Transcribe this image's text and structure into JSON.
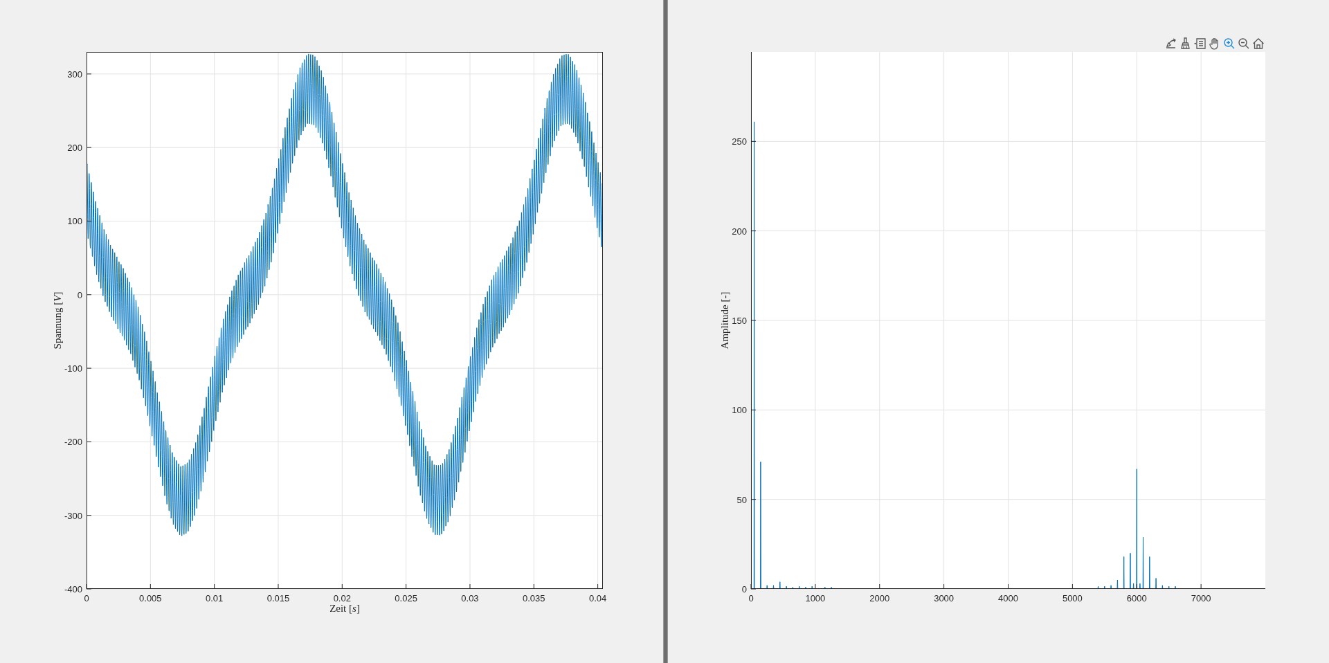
{
  "figures": [
    {
      "kind": "time",
      "box": true,
      "xlabel": "Zeit [*s*]",
      "ylabel": "Spannung [*V*]",
      "xticks": [
        "0",
        "0.005",
        "0.01",
        "0.015",
        "0.02",
        "0.025",
        "0.03",
        "0.035",
        "0.04"
      ],
      "yticks": [
        "300",
        "200",
        "100",
        "0",
        "-100",
        "-200",
        "-300",
        "-400"
      ]
    },
    {
      "kind": "spectrum",
      "box": false,
      "ylabel": "Amplitude [-]",
      "xticks": [
        "0",
        "1000",
        "2000",
        "3000",
        "4000",
        "5000",
        "6000",
        "7000"
      ],
      "yticks": [
        "250",
        "200",
        "150",
        "100",
        "50",
        "0"
      ]
    }
  ],
  "toolbar": {
    "tools": [
      {
        "kind": "export"
      },
      {
        "kind": "brush"
      },
      {
        "kind": "datatip"
      },
      {
        "kind": "pan"
      },
      {
        "kind": "zoom-in"
      },
      {
        "kind": "zoom-out"
      },
      {
        "kind": "home"
      }
    ]
  }
}
